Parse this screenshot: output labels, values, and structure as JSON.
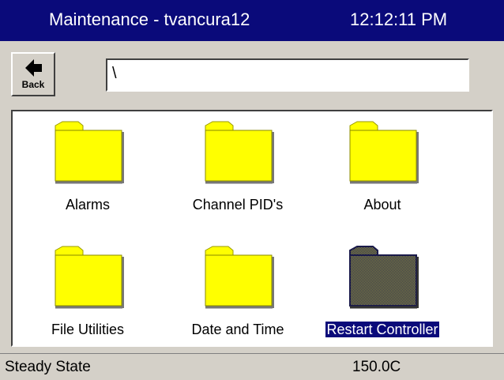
{
  "header": {
    "title": "Maintenance - tvancura12",
    "time": "12:12:11 PM"
  },
  "toolbar": {
    "back_label": "Back",
    "back_icon": "arrow-left-icon",
    "path_value": "\\"
  },
  "folders": [
    {
      "label": "Alarms",
      "selected": false
    },
    {
      "label": "Channel PID's",
      "selected": false
    },
    {
      "label": "About",
      "selected": false
    },
    {
      "label": "File Utilities",
      "selected": false
    },
    {
      "label": "Date and Time",
      "selected": false
    },
    {
      "label": "Restart Controller",
      "selected": true
    }
  ],
  "status": {
    "state": "Steady State",
    "temperature": "150.0C"
  },
  "colors": {
    "titlebar": "#0a0a7a",
    "folder": "#ffff00",
    "selection": "#0a0a7a"
  }
}
